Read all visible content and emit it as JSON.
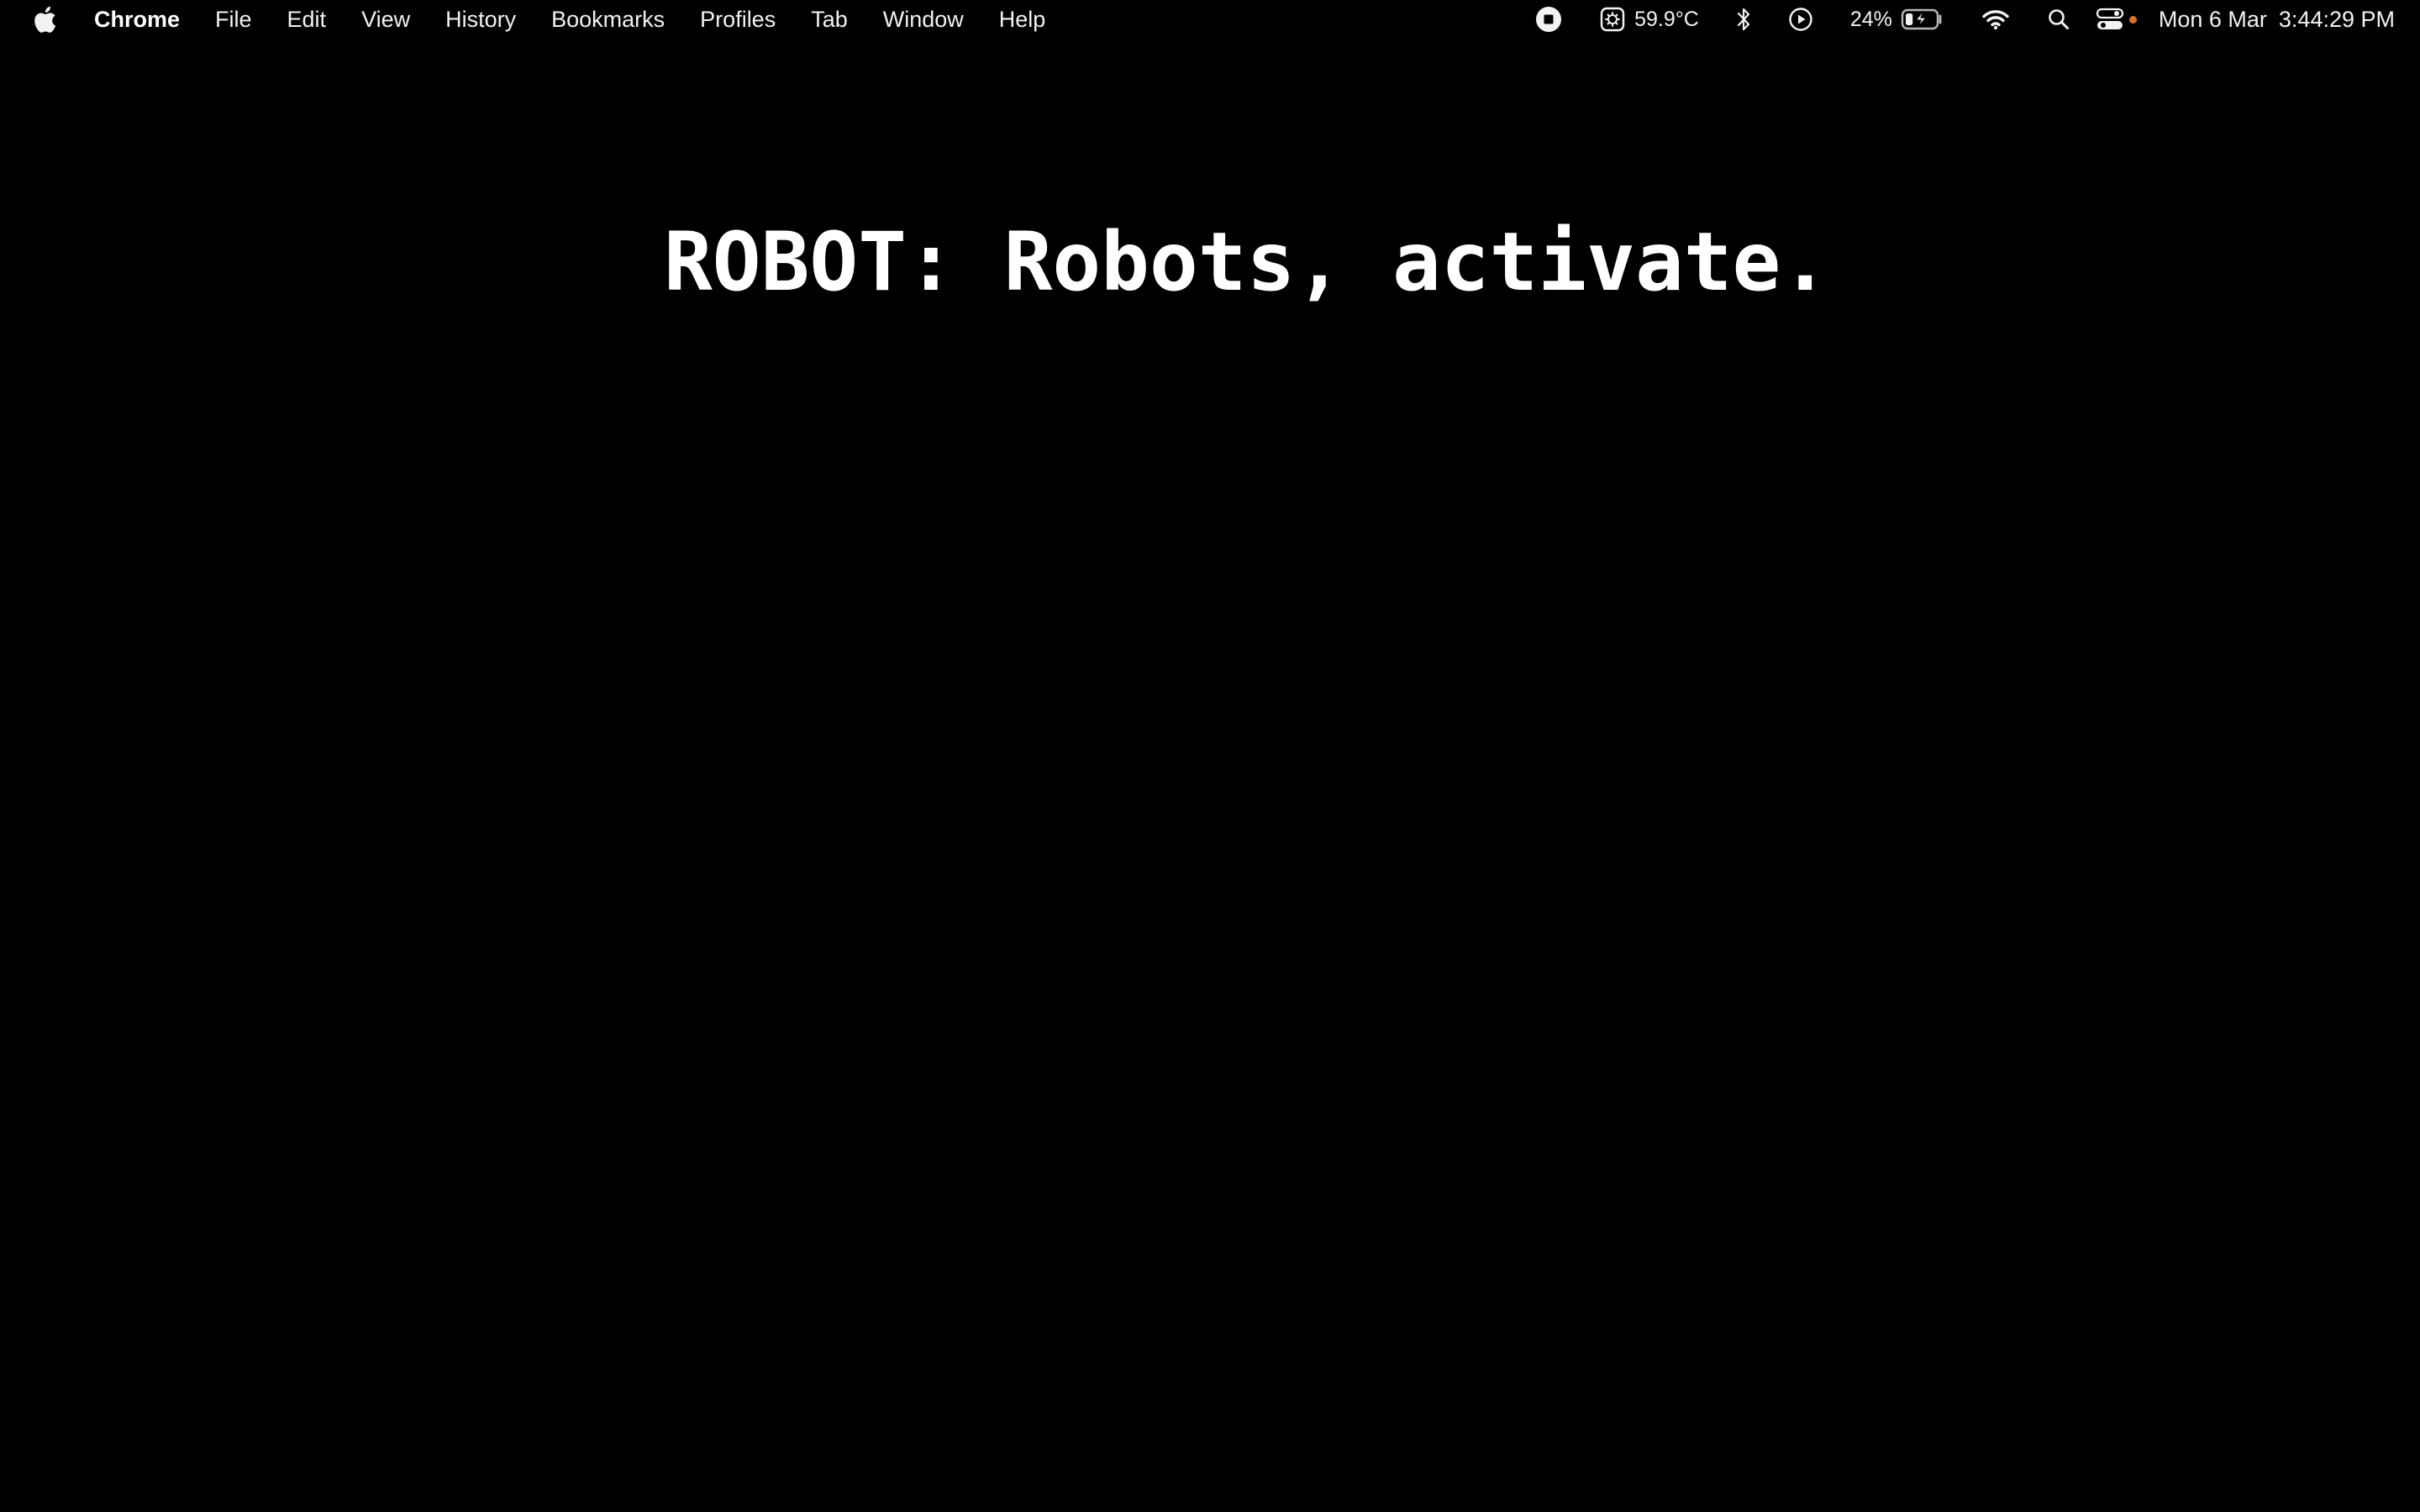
{
  "menubar": {
    "app_name": "Chrome",
    "items": [
      "File",
      "Edit",
      "View",
      "History",
      "Bookmarks",
      "Profiles",
      "Tab",
      "Window",
      "Help"
    ],
    "status": {
      "temperature": "59.9°C",
      "battery_percent": "24%",
      "battery_level": 0.24,
      "date": "Mon 6 Mar",
      "time": "3:44:29 PM"
    },
    "icons": [
      "apple-logo-icon",
      "screen-record-stop-icon",
      "cpu-temperature-icon",
      "bluetooth-icon",
      "play-icon",
      "battery-charging-icon",
      "wifi-icon",
      "search-icon",
      "control-center-icon"
    ],
    "colors": {
      "background": "#000000",
      "text": "#f2f2f2",
      "indicator_dot": "#d9722a"
    }
  },
  "content": {
    "caption": "ROBOT: Robots, activate."
  }
}
